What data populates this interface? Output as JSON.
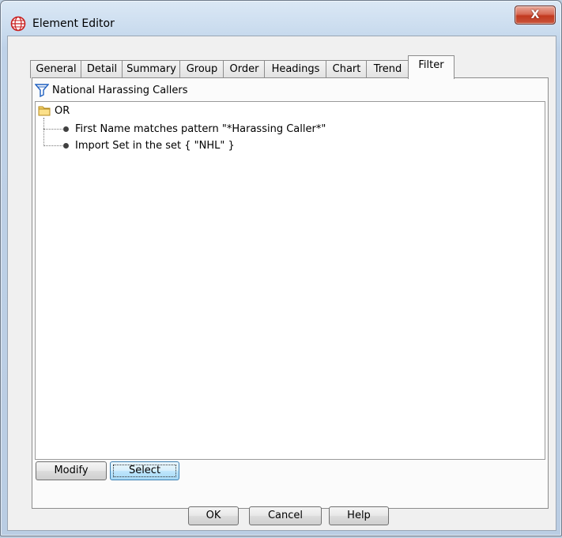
{
  "window": {
    "title": "Element Editor",
    "close_label": "X"
  },
  "tabs": [
    {
      "label": "General"
    },
    {
      "label": "Detail"
    },
    {
      "label": "Summary"
    },
    {
      "label": "Group"
    },
    {
      "label": "Order"
    },
    {
      "label": "Headings"
    },
    {
      "label": "Chart"
    },
    {
      "label": "Trend"
    },
    {
      "label": "Filter"
    }
  ],
  "active_tab": "Filter",
  "filter": {
    "name": "National Harassing Callers",
    "tree": {
      "root": "OR",
      "children": [
        {
          "label": "First Name matches pattern \"*Harassing Caller*\""
        },
        {
          "label": "Import Set in the set { \"NHL\" }"
        }
      ]
    }
  },
  "panel_buttons": {
    "modify": "Modify",
    "select": "Select"
  },
  "dialog_buttons": {
    "ok": "OK",
    "cancel": "Cancel",
    "help": "Help"
  },
  "colors": {
    "title_bar": "#c9dbee",
    "close_button": "#c2391f",
    "focus_button": "#bee6fd"
  }
}
